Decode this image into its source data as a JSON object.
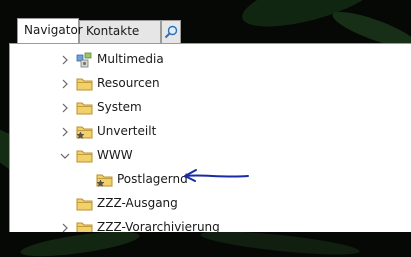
{
  "tabs": [
    {
      "label": "Navigator",
      "active": true
    },
    {
      "label": "Kontakte",
      "active": false
    }
  ],
  "tree": {
    "items": [
      {
        "label": "Multimedia",
        "icon": "multimedia-folder-icon",
        "expanded": false
      },
      {
        "label": "Resourcen",
        "icon": "folder-icon",
        "expanded": false
      },
      {
        "label": "System",
        "icon": "folder-icon",
        "expanded": false
      },
      {
        "label": "Unverteilt",
        "icon": "starred-folder-icon",
        "expanded": false
      },
      {
        "label": "WWW",
        "icon": "folder-icon",
        "expanded": true
      },
      {
        "label": "Postlagernd",
        "icon": "starred-folder-icon",
        "expanded": false
      },
      {
        "label": "ZZZ-Ausgang",
        "icon": "folder-icon",
        "expanded": false
      },
      {
        "label": "ZZZ-Vorarchivierung",
        "icon": "folder-icon",
        "expanded": false
      }
    ]
  },
  "colors": {
    "folder_fill": "#f2d16b",
    "folder_stroke": "#b8912c",
    "annotation_arrow": "#1a2ba8"
  }
}
